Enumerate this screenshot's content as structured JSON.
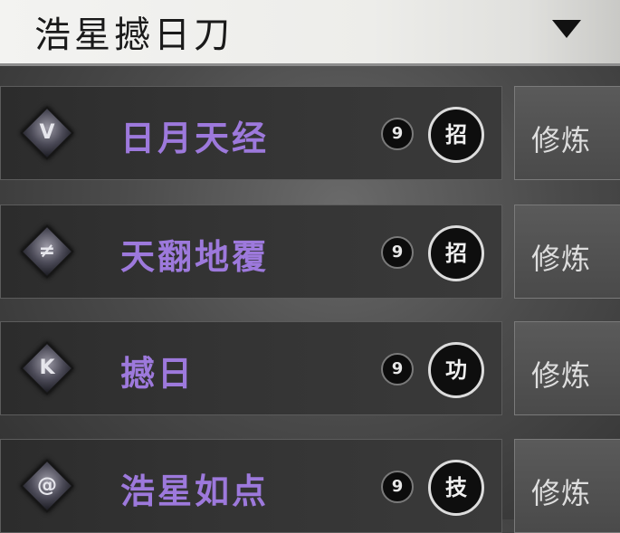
{
  "header": {
    "title": "浩星撼日刀"
  },
  "skills": [
    {
      "name": "日月天经",
      "count": "9",
      "type": "招",
      "action_label": "修炼",
      "icon": "cracked-sigil-icon"
    },
    {
      "name": "天翻地覆",
      "count": "9",
      "type": "招",
      "action_label": "修炼",
      "icon": "slash-sigil-icon"
    },
    {
      "name": "撼日",
      "count": "9",
      "type": "功",
      "action_label": "修炼",
      "icon": "sword-sigil-icon"
    },
    {
      "name": "浩星如点",
      "count": "9",
      "type": "技",
      "action_label": "修炼",
      "icon": "swirl-sigil-icon"
    }
  ],
  "colors": {
    "skill_name": "#9d79dc",
    "panel": "#333333",
    "header_bg": "#efefec"
  }
}
